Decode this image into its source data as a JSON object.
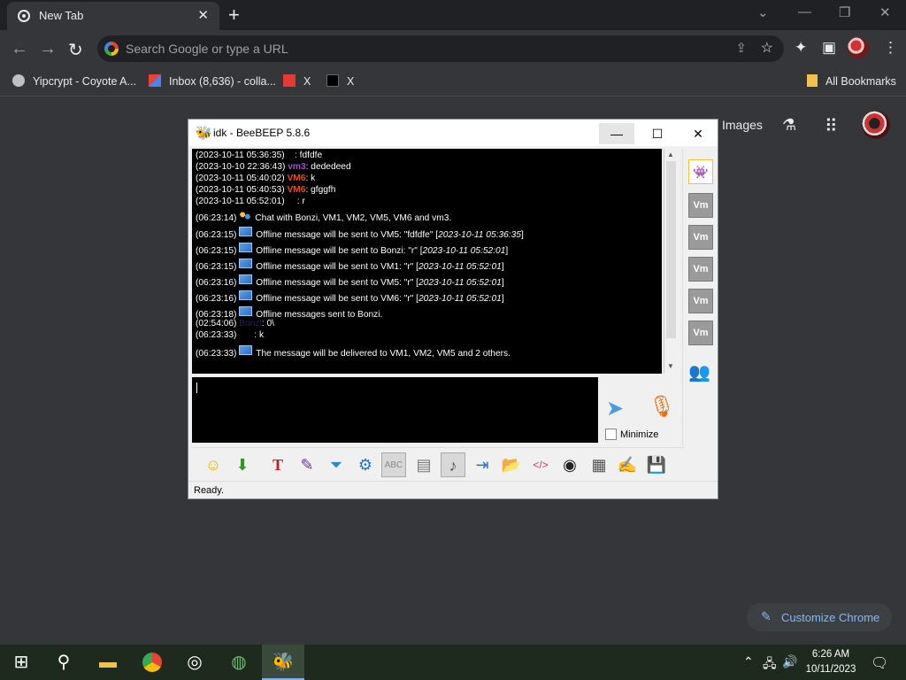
{
  "browser": {
    "tab": {
      "title": "New Tab",
      "close": "✕",
      "favicon": "chrome-icon"
    },
    "new_tab": "+",
    "window_controls": {
      "dropdown": "⌄",
      "minimize": "—",
      "restore": "❐",
      "close": "✕"
    },
    "nav": {
      "back": "←",
      "forward": "→",
      "reload": "↻"
    },
    "omnibox": {
      "placeholder": "Search Google or type a URL",
      "share": "⇪",
      "star": "☆"
    },
    "toolbar_icons": {
      "extensions": "✦",
      "sidepanel": "▣",
      "menu": "⋮"
    },
    "bookmarks": [
      {
        "label": "Yipcrypt - Coyote A...",
        "icon": "globe-icon"
      },
      {
        "label": "Inbox (8,636) - colla...",
        "icon": "gmail-icon"
      },
      {
        "label": "X",
        "icon": "x-red-icon"
      },
      {
        "label": "X",
        "icon": "x-icon"
      }
    ],
    "all_bookmarks": "All Bookmarks"
  },
  "ntp": {
    "images": "Images",
    "labs": "⚗",
    "apps": "⠿",
    "customize": {
      "pen": "✎",
      "label": "Customize Chrome"
    }
  },
  "beebeep": {
    "title": "idk - BeeBEEP 5.8.6",
    "controls": {
      "minimize": "—",
      "maximize": "☐",
      "close": "✕"
    },
    "chat": [
      {
        "ts": "(2023-10-11 05:36:35)",
        "user": "",
        "msg": ": fdfdfe"
      },
      {
        "ts": "(2023-10-10 22:36:43)",
        "user": "vm3",
        "msg": ": dededeed"
      },
      {
        "ts": "(2023-10-11 05:40:02)",
        "user": "VM6",
        "msg": ": k"
      },
      {
        "ts": "(2023-10-11 05:40:53)",
        "user": "VM6",
        "msg": ": gfggfh"
      },
      {
        "ts": "(2023-10-11 05:52:01)",
        "user": "",
        "msg": ": r"
      },
      {
        "ts": "(06:23:14)",
        "text": "Chat with Bonzi, VM1, VM2, VM5, VM6 and vm3."
      },
      {
        "ts": "(06:23:15)",
        "text": "Offline message will be sent to VM5: \"fdfdfe\" [",
        "when": "2023-10-11 05:36:35",
        "end": "]"
      },
      {
        "ts": "(06:23:15)",
        "text": "Offline message will be sent to Bonzi: \"r\" [",
        "when": "2023-10-11 05:52:01",
        "end": "]"
      },
      {
        "ts": "(06:23:15)",
        "text": "Offline message will be sent to VM1: \"r\" [",
        "when": "2023-10-11 05:52:01",
        "end": "]"
      },
      {
        "ts": "(06:23:16)",
        "text": "Offline message will be sent to VM5: \"r\" [",
        "when": "2023-10-11 05:52:01",
        "end": "]"
      },
      {
        "ts": "(06:23:16)",
        "text": "Offline message will be sent to VM6: \"r\" [",
        "when": "2023-10-11 05:52:01",
        "end": "]"
      },
      {
        "ts": "(06:23:18)",
        "text": "Offline messages sent to Bonzi."
      },
      {
        "ts": "(02:54:06)",
        "user": "Bonzi",
        "msg": ": 0\\"
      },
      {
        "ts": "(06:23:33)",
        "user": "",
        "msg": ": k"
      },
      {
        "ts": "(06:23:33)",
        "text": "The message will be delivered to VM1, VM2, VM5 and 2 others."
      }
    ],
    "users": [
      "Vm",
      "Vm",
      "Vm",
      "Vm",
      "Vm"
    ],
    "minimize_label": "Minimize",
    "status": "Ready.",
    "tools": [
      "smiley-icon",
      "download-icon",
      "font-icon",
      "color-icon",
      "filter-icon",
      "settings-icon",
      "spellcheck-icon",
      "autocomplete-icon",
      "note-icon",
      "export-icon",
      "folder-icon",
      "html-icon",
      "camera-icon",
      "screenshot-icon",
      "edit-icon",
      "save-icon"
    ]
  },
  "taskbar": {
    "time": "6:26 AM",
    "date": "10/11/2023"
  }
}
